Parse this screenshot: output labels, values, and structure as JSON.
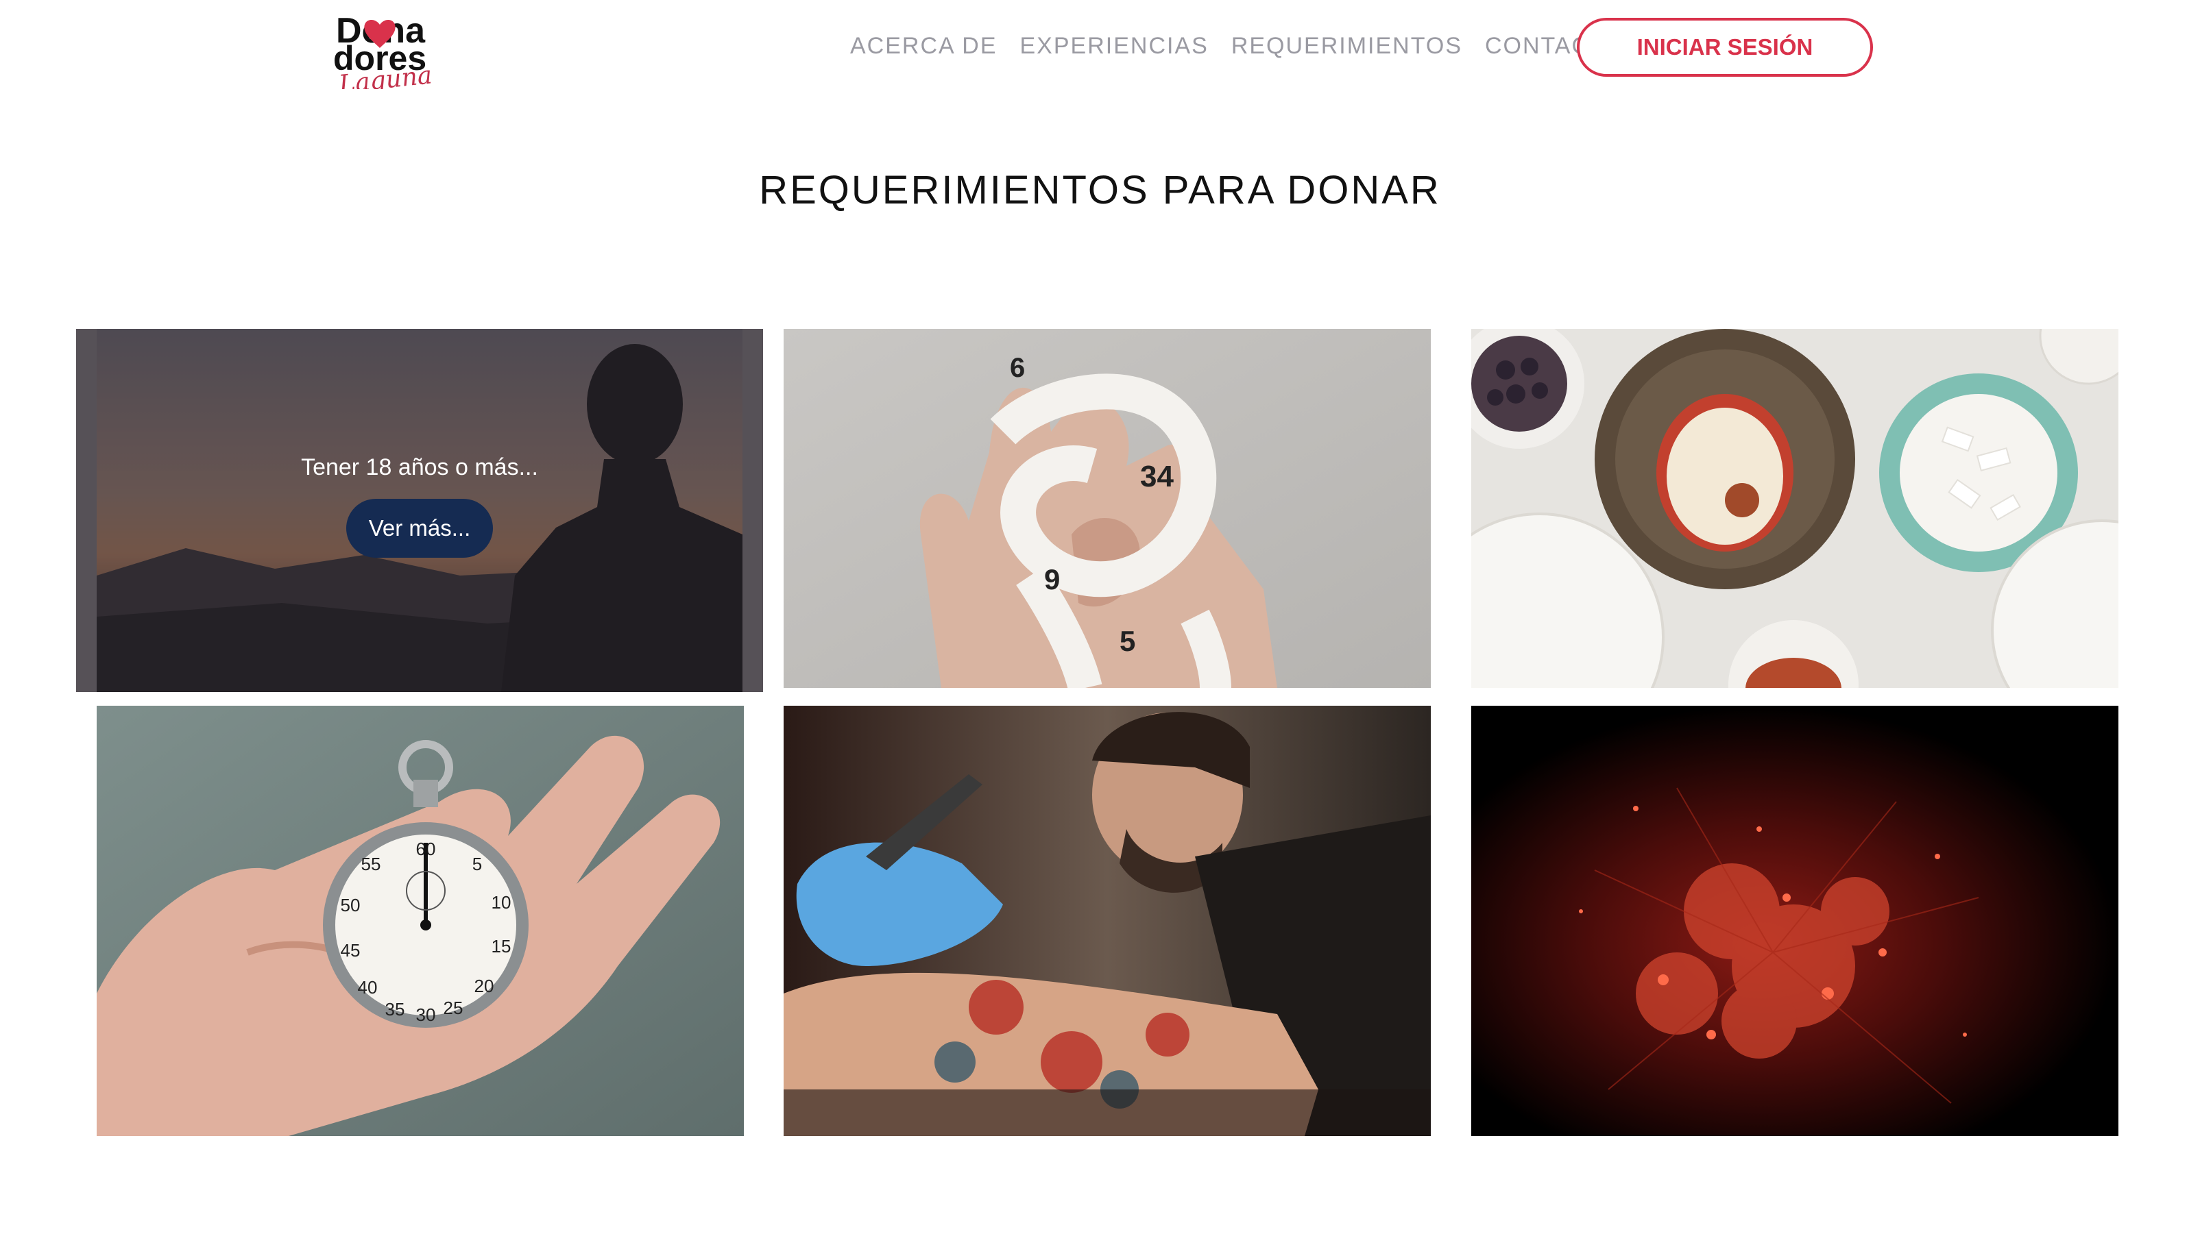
{
  "header": {
    "logo_text_top": "Dona",
    "logo_text_mid": "dores",
    "logo_text_script": "Laguna",
    "nav": [
      {
        "label": "ACERCA DE"
      },
      {
        "label": "EXPERIENCIAS"
      },
      {
        "label": "REQUERIMIENTOS"
      },
      {
        "label": "CONTACTO"
      }
    ],
    "login_label": "INICIAR SESIÓN"
  },
  "main": {
    "title": "REQUERIMIENTOS PARA DONAR",
    "cards": [
      {
        "image": "silhouette-sunset-photo",
        "overlay_text": "Tener 18 años o más...",
        "overlay_button": "Ver más..."
      },
      {
        "image": "measuring-tape-hand-photo"
      },
      {
        "image": "food-bowls-pear-photo"
      },
      {
        "image": "stopwatch-hand-photo"
      },
      {
        "image": "tattoo-artist-photo"
      },
      {
        "image": "red-fireworks-photo"
      }
    ]
  },
  "colors": {
    "accent": "#d9324b",
    "nav_text": "#9a9aa2",
    "button_navy": "#152b52"
  }
}
